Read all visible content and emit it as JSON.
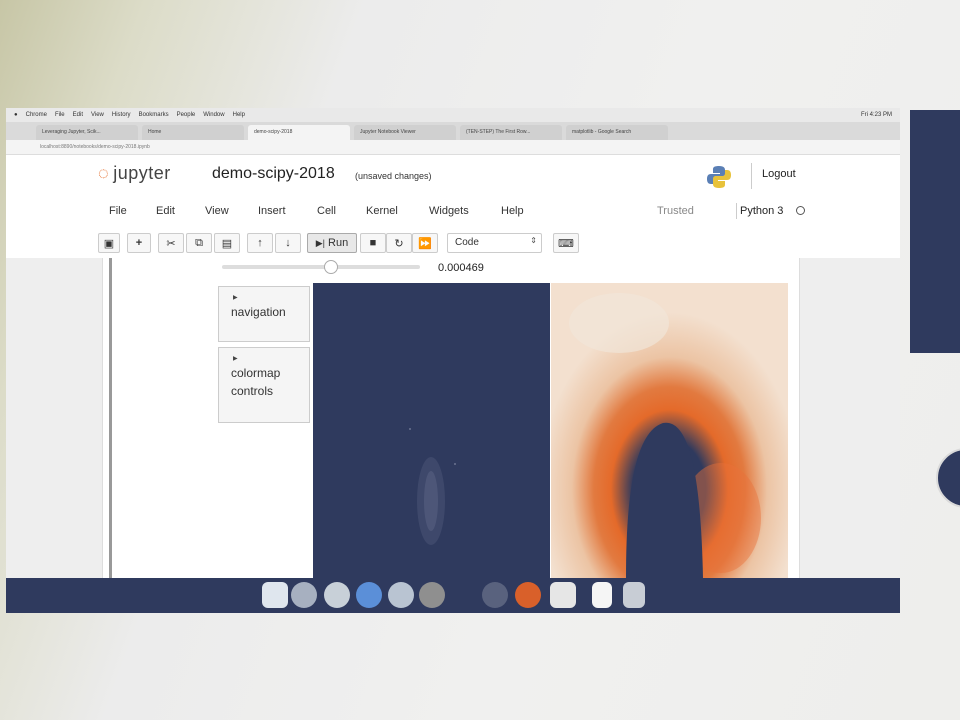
{
  "os_menubar": {
    "items": [
      "Chrome",
      "File",
      "Edit",
      "View",
      "History",
      "Bookmarks",
      "People",
      "Window",
      "Help"
    ],
    "clock": "Fri 4:23 PM"
  },
  "browser": {
    "tabs": [
      "Leveraging Jupyter, Scik...",
      "Home",
      "demo-scipy-2018",
      "Jupyter Notebook Viewer",
      "(TEN-STEP) The First Row...",
      "matplotlib - Google Search"
    ],
    "address": "localhost:8890/notebooks/demo-scipy-2018.ipynb"
  },
  "notebook": {
    "logo_text": "jupyter",
    "title": "demo-scipy-2018",
    "status": "(unsaved changes)",
    "logout_label": "Logout",
    "menu": [
      "File",
      "Edit",
      "View",
      "Insert",
      "Cell",
      "Kernel",
      "Widgets",
      "Help"
    ],
    "trusted_label": "Trusted",
    "kernel_name": "Python 3"
  },
  "toolbar": {
    "save_icon": "floppy-icon",
    "add_label": "+",
    "run_label": "Run",
    "cell_type": "Code"
  },
  "widget": {
    "slider_value": "0.000469",
    "slider_fraction": 0.55,
    "accordion": [
      {
        "label_line1": "navigation",
        "label_line2": ""
      },
      {
        "label_line1": "colormap",
        "label_line2": "controls"
      }
    ]
  },
  "colors": {
    "navy": "#2f3a5e",
    "orange": "#e46a2a",
    "jupyter_orange": "#e46e2e"
  },
  "dock": {
    "icons": [
      "finder-icon",
      "launchpad-icon",
      "safari-icon",
      "app-store-icon",
      "compass-icon",
      "photos-icon",
      "system-icon",
      "chrome-icon",
      "slack-icon",
      "notes-icon",
      "trash-icon"
    ]
  }
}
